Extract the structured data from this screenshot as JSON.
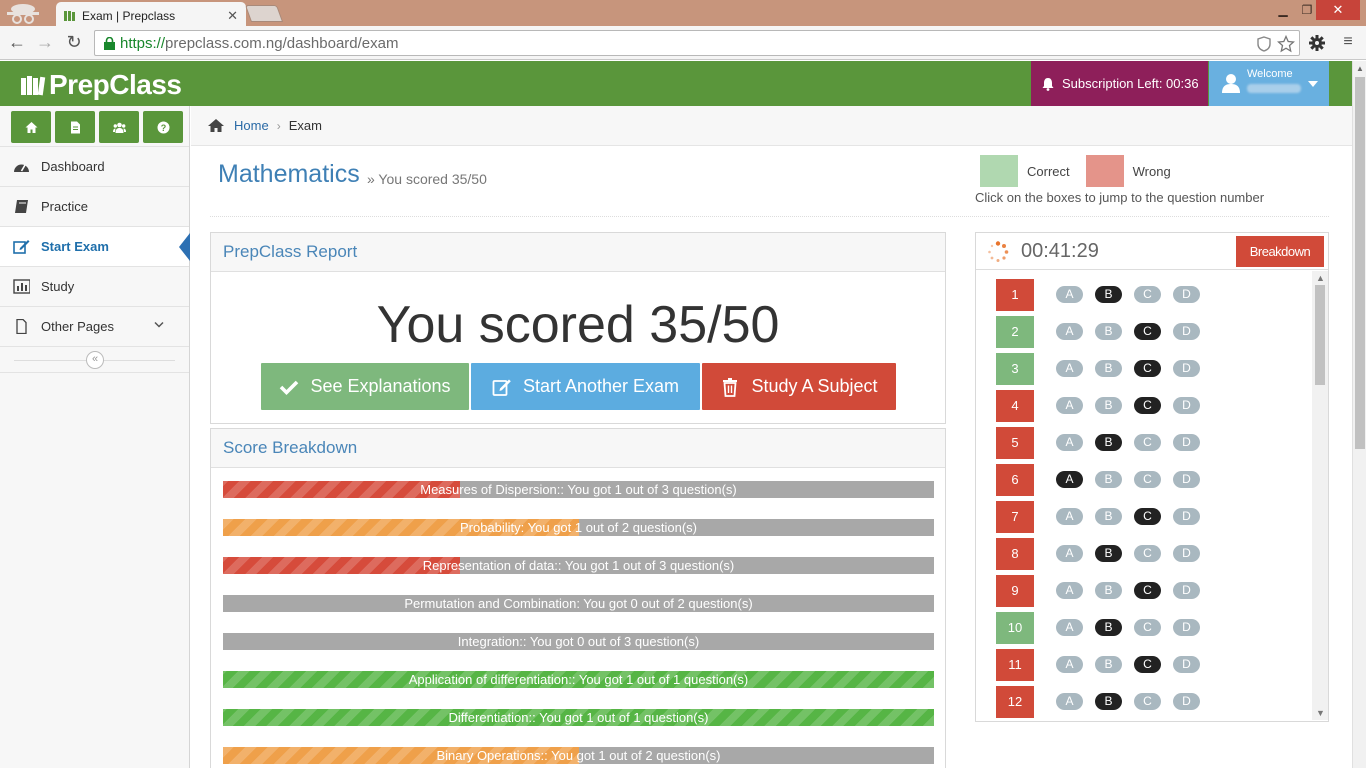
{
  "browser": {
    "tab_title": "Exam | Prepclass",
    "url_scheme": "https://",
    "url_rest": "prepclass.com.ng/dashboard/exam"
  },
  "header": {
    "logo": "PrepClass",
    "subscription": "Subscription Left: 00:36",
    "welcome": "Welcome"
  },
  "sidebar": {
    "items": [
      {
        "label": "Dashboard",
        "icon": "dashboard-icon"
      },
      {
        "label": "Practice",
        "icon": "book-icon"
      },
      {
        "label": "Start Exam",
        "icon": "edit-icon"
      },
      {
        "label": "Study",
        "icon": "bar-chart-icon"
      },
      {
        "label": "Other Pages",
        "icon": "file-icon"
      }
    ]
  },
  "breadcrumb": {
    "home": "Home",
    "current": "Exam"
  },
  "page": {
    "title": "Mathematics",
    "subtitle": "» You scored 35/50",
    "legend_correct": "Correct",
    "legend_wrong": "Wrong",
    "hint": "Click on the boxes to jump to the question number"
  },
  "report": {
    "title": "PrepClass Report",
    "score": "You scored 35/50",
    "btn_explanations": "See Explanations",
    "btn_another": "Start Another Exam",
    "btn_study": "Study A Subject"
  },
  "breakdown": {
    "title": "Score Breakdown",
    "items": [
      {
        "text": "Measures of Dispersion:: You got 1 out of 3 question(s)",
        "ratio": 0.333,
        "color": "#d64b3b"
      },
      {
        "text": "Probability: You got 1 out of 2 question(s)",
        "ratio": 0.5,
        "color": "#efa04a"
      },
      {
        "text": "Representation of data:: You got 1 out of 3 question(s)",
        "ratio": 0.333,
        "color": "#d64b3b"
      },
      {
        "text": "Permutation and Combination: You got 0 out of 2 question(s)",
        "ratio": 0,
        "color": "#a8a8a8"
      },
      {
        "text": "Integration:: You got 0 out of 3 question(s)",
        "ratio": 0,
        "color": "#a8a8a8"
      },
      {
        "text": "Application of differentiation:: You got 1 out of 1 question(s)",
        "ratio": 1,
        "color": "#56b545"
      },
      {
        "text": "Differentiation:: You got 1 out of 1 question(s)",
        "ratio": 1,
        "color": "#56b545"
      },
      {
        "text": "Binary Operations:: You got 1 out of 2 question(s)",
        "ratio": 0.5,
        "color": "#efa04a"
      }
    ]
  },
  "timer": {
    "time": "00:41:29",
    "breakdown_label": "Breakdown"
  },
  "colors": {
    "correct": "#7eb87d",
    "wrong": "#d14a39",
    "legend_correct": "#b0d8b0",
    "legend_wrong": "#e4948a"
  },
  "options_labels": [
    "A",
    "B",
    "C",
    "D"
  ],
  "questions": [
    {
      "num": "1",
      "status": "wrong",
      "selected": "B"
    },
    {
      "num": "2",
      "status": "correct",
      "selected": "C"
    },
    {
      "num": "3",
      "status": "correct",
      "selected": "C"
    },
    {
      "num": "4",
      "status": "wrong",
      "selected": "C"
    },
    {
      "num": "5",
      "status": "wrong",
      "selected": "B"
    },
    {
      "num": "6",
      "status": "wrong",
      "selected": "A"
    },
    {
      "num": "7",
      "status": "wrong",
      "selected": "C"
    },
    {
      "num": "8",
      "status": "wrong",
      "selected": "B"
    },
    {
      "num": "9",
      "status": "wrong",
      "selected": "C"
    },
    {
      "num": "10",
      "status": "correct",
      "selected": "B"
    },
    {
      "num": "11",
      "status": "wrong",
      "selected": "C"
    },
    {
      "num": "12",
      "status": "wrong",
      "selected": "B"
    }
  ]
}
